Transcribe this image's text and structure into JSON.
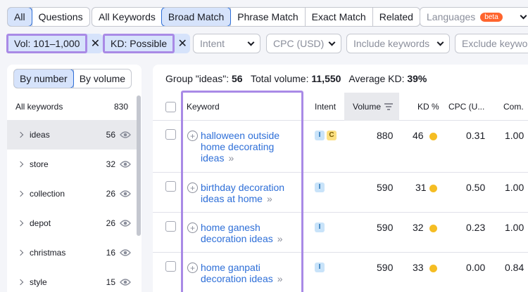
{
  "top_tabs": {
    "all": "All",
    "questions": "Questions"
  },
  "match_tabs": {
    "all_keywords": "All Keywords",
    "broad": "Broad Match",
    "phrase": "Phrase Match",
    "exact": "Exact Match",
    "related": "Related"
  },
  "languages": {
    "label": "Languages",
    "badge": "beta"
  },
  "filters": {
    "vol_chip": "Vol: 101–1,000",
    "kd_chip": "KD: Possible",
    "intent": "Intent",
    "cpc": "CPC (USD)",
    "include": "Include keywords",
    "exclude": "Exclude keywo"
  },
  "sidebar": {
    "toggle": {
      "by_number": "By number",
      "by_volume": "By volume"
    },
    "all_keywords": {
      "label": "All keywords",
      "count": "830"
    },
    "groups": [
      {
        "name": "ideas",
        "count": "56"
      },
      {
        "name": "store",
        "count": "32"
      },
      {
        "name": "collection",
        "count": "26"
      },
      {
        "name": "depot",
        "count": "26"
      },
      {
        "name": "christmas",
        "count": "16"
      },
      {
        "name": "style",
        "count": "15"
      }
    ]
  },
  "summary": {
    "group_label": "Group \"ideas\":",
    "group_count": "56",
    "volume_label": "Total volume:",
    "volume_value": "11,550",
    "kd_label": "Average KD:",
    "kd_value": "39%"
  },
  "columns": {
    "keyword": "Keyword",
    "intent": "Intent",
    "volume": "Volume",
    "kd": "KD %",
    "cpc": "CPC (U...",
    "com": "Com."
  },
  "rows": [
    {
      "keyword": [
        "halloween outside",
        "home decorating",
        "ideas"
      ],
      "intents": [
        "I",
        "C"
      ],
      "volume": "880",
      "kd": "46",
      "cpc": "0.31",
      "com": "1.00"
    },
    {
      "keyword": [
        "birthday decoration",
        "ideas at home"
      ],
      "intents": [
        "I"
      ],
      "volume": "590",
      "kd": "31",
      "cpc": "0.50",
      "com": "1.00"
    },
    {
      "keyword": [
        "home ganesh",
        "decoration ideas"
      ],
      "intents": [
        "I"
      ],
      "volume": "590",
      "kd": "32",
      "cpc": "0.23",
      "com": "1.00"
    },
    {
      "keyword": [
        "home ganpati",
        "decoration ideas"
      ],
      "intents": [
        "I"
      ],
      "volume": "590",
      "kd": "33",
      "cpc": "0.00",
      "com": "0.84"
    }
  ],
  "colors": {
    "accent": "#2e6fd8",
    "highlight": "#a98ae6",
    "kd_dot": "#f5bd23"
  }
}
